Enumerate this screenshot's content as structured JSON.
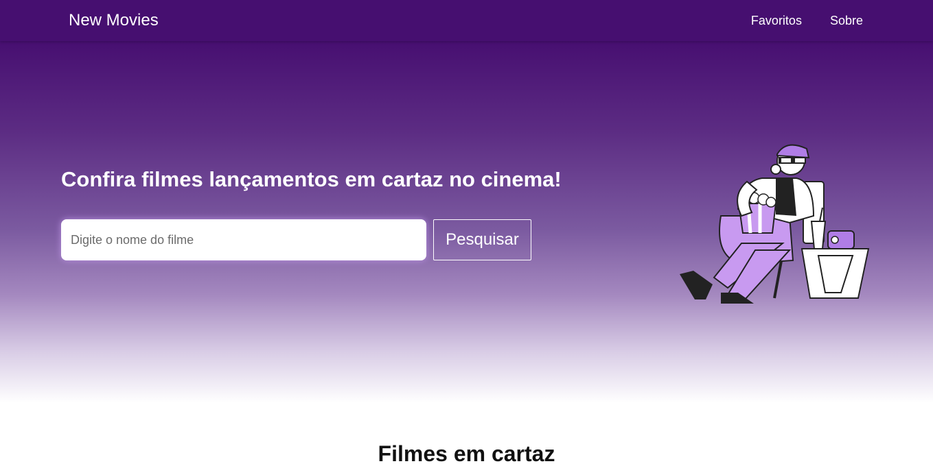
{
  "nav": {
    "brand": "New Movies",
    "links": [
      {
        "label": "Favoritos"
      },
      {
        "label": "Sobre"
      }
    ]
  },
  "hero": {
    "title": "Confira filmes lançamentos em cartaz no cinema!",
    "search": {
      "placeholder": "Digite o nome do filme",
      "value": "",
      "button_label": "Pesquisar"
    },
    "illustration_icon": "person-watching-movie-illustration"
  },
  "section": {
    "title": "Filmes em cartaz"
  },
  "colors": {
    "navbar": "#460f70",
    "accent": "#b07de6",
    "illustration_fill": "#c89af0"
  }
}
